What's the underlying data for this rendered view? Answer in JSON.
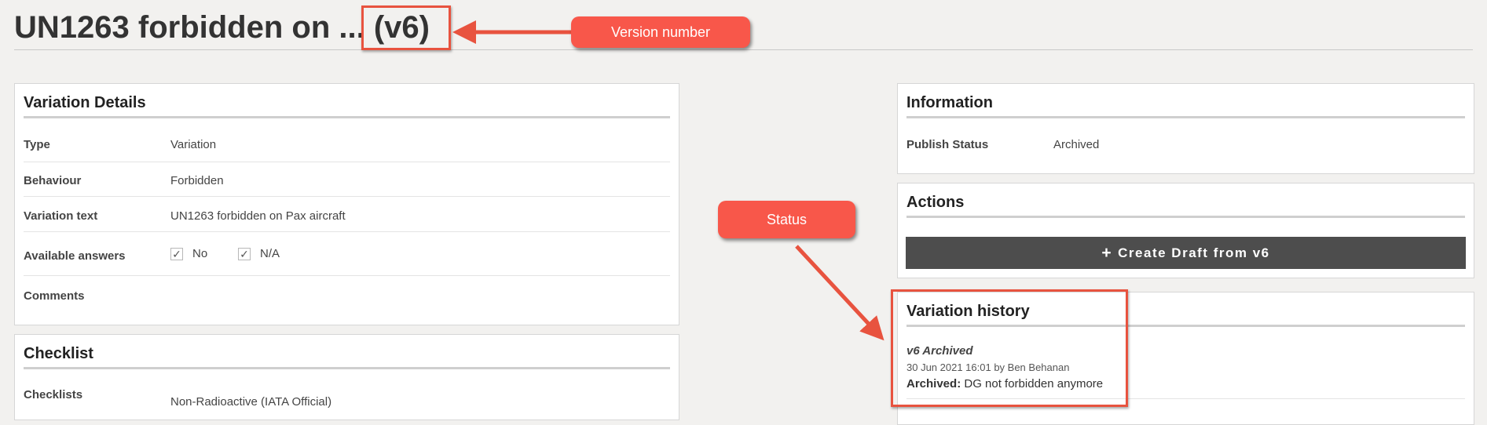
{
  "page": {
    "title": "UN1263 forbidden on ... (v6)"
  },
  "variation_details": {
    "title": "Variation Details",
    "rows": [
      {
        "label": "Type",
        "value": "Variation"
      },
      {
        "label": "Behaviour",
        "value": "Forbidden"
      },
      {
        "label": "Variation text",
        "value": "UN1263 forbidden on Pax aircraft"
      },
      {
        "label": "Available answers",
        "value": ""
      },
      {
        "label": "Comments",
        "value": ""
      }
    ],
    "answers": [
      {
        "label": "No",
        "checked": true
      },
      {
        "label": "N/A",
        "checked": true
      }
    ]
  },
  "checklist": {
    "title": "Checklist",
    "label": "Checklists",
    "value": "Non-Radioactive (IATA Official)"
  },
  "information": {
    "title": "Information",
    "publish_status_label": "Publish Status",
    "publish_status_value": "Archived"
  },
  "actions": {
    "title": "Actions",
    "create_draft_label": "Create Draft from v6"
  },
  "variation_history": {
    "title": "Variation history",
    "entries": [
      {
        "version": "v6 Archived",
        "meta": "30 Jun 2021 16:01 by Ben Behanan",
        "note_label": "Archived:",
        "note_text": "DG not forbidden anymore"
      }
    ]
  },
  "annotations": {
    "version_callout": "Version number",
    "status_callout": "Status",
    "callout_color": "#f8574a"
  },
  "icons": {
    "check": "check-icon",
    "plus": "plus-icon"
  }
}
